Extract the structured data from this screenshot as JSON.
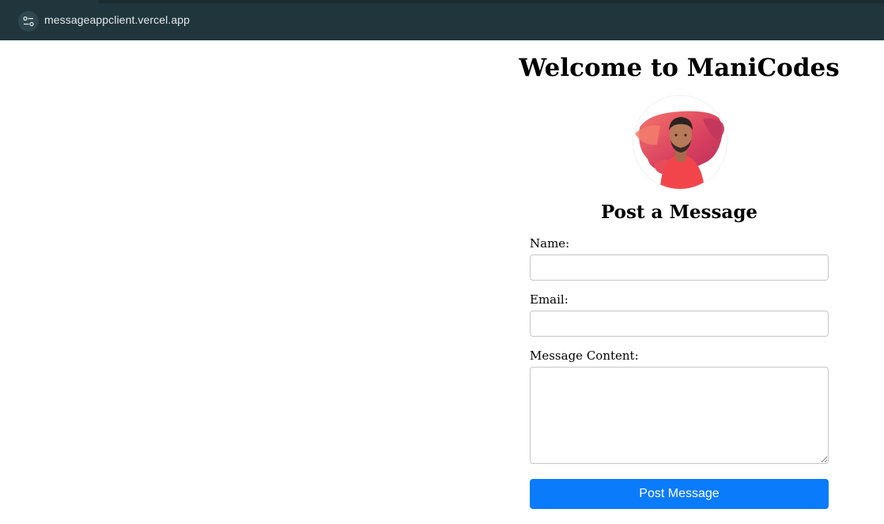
{
  "browser": {
    "url": "messageappclient.vercel.app",
    "site_info_icon": "tune-icon"
  },
  "page": {
    "title": "Welcome to ManiCodes",
    "avatar_icon": "profile-photo",
    "form_title": "Post a Message",
    "fields": {
      "name_label": "Name:",
      "name_value": "",
      "email_label": "Email:",
      "email_value": "",
      "message_label": "Message Content:",
      "message_value": ""
    },
    "submit_label": "Post Message"
  },
  "colors": {
    "browser_bar": "#20363c",
    "button": "#0a7bfa",
    "button_text": "#ffffff"
  }
}
